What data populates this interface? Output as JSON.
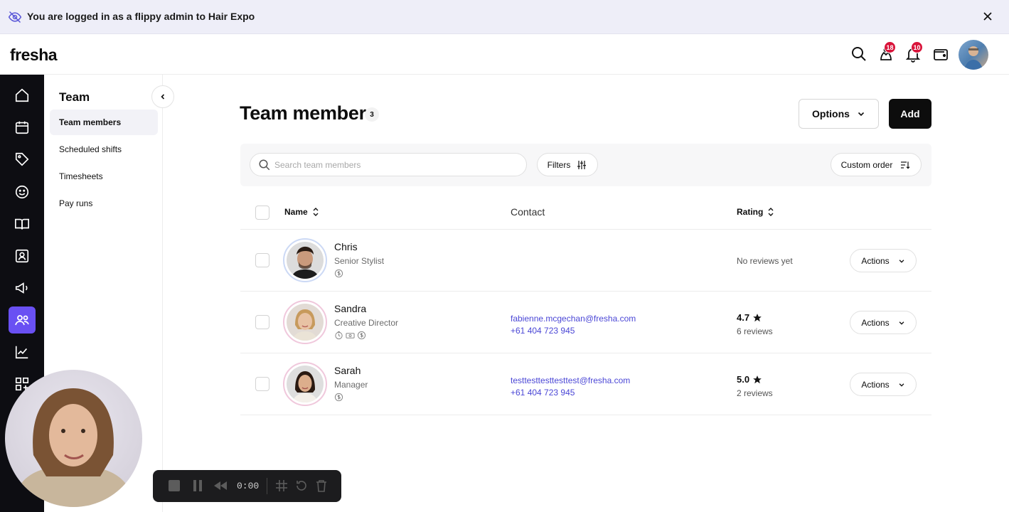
{
  "banner": {
    "text": "You are logged in as a flippy admin to Hair Expo"
  },
  "topbar": {
    "logo": "fresha",
    "notif_1_count": "18",
    "notif_2_count": "10"
  },
  "subnav": {
    "title": "Team",
    "items": [
      {
        "label": "Team members"
      },
      {
        "label": "Scheduled shifts"
      },
      {
        "label": "Timesheets"
      },
      {
        "label": "Pay runs"
      }
    ]
  },
  "main": {
    "title": "Team members",
    "count": "3",
    "options_label": "Options",
    "add_label": "Add",
    "search_placeholder": "Search team members",
    "filters_label": "Filters",
    "order_label": "Custom order",
    "columns": {
      "name": "Name",
      "contact": "Contact",
      "rating": "Rating"
    }
  },
  "members": [
    {
      "name": "Chris",
      "role": "Senior Stylist",
      "email": "",
      "phone": "",
      "rating": "",
      "reviews": "",
      "no_reviews": "No reviews yet",
      "actions": "Actions"
    },
    {
      "name": "Sandra",
      "role": "Creative Director",
      "email": "fabienne.mcgechan@fresha.com",
      "phone": "+61 404 723 945",
      "rating": "4.7",
      "reviews": "6 reviews",
      "no_reviews": "",
      "actions": "Actions"
    },
    {
      "name": "Sarah",
      "role": "Manager",
      "email": "testtesttesttesttest@fresha.com",
      "phone": "+61 404 723 945",
      "rating": "5.0",
      "reviews": "2 reviews",
      "no_reviews": "",
      "actions": "Actions"
    }
  ],
  "recorder": {
    "time": "0:00"
  },
  "colors": {
    "accent": "#6950f3",
    "link": "#4b47d6",
    "badge": "#d9143a",
    "rail": "#0d0d12"
  }
}
